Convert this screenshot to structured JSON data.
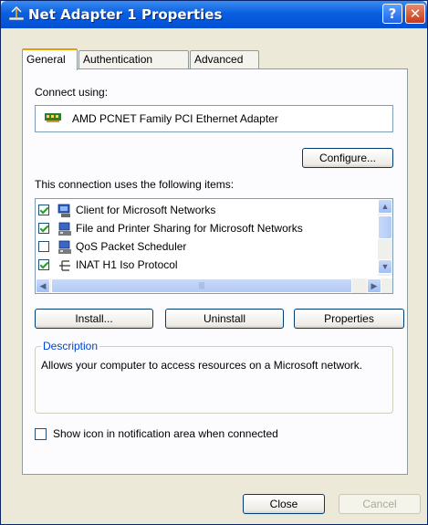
{
  "window": {
    "title": "Net Adapter 1 Properties",
    "help_label": "?",
    "close_label": "✕"
  },
  "tabs": [
    {
      "label": "General",
      "active": true
    },
    {
      "label": "Authentication",
      "active": false
    },
    {
      "label": "Advanced",
      "active": false
    }
  ],
  "general": {
    "connect_using_label": "Connect using:",
    "adapter_name": "AMD PCNET Family PCI Ethernet Adapter",
    "configure_label": "Configure...",
    "items_label": "This connection uses the following items:",
    "items": [
      {
        "label": "Client for Microsoft Networks",
        "checked": true,
        "icon": "network-client-icon"
      },
      {
        "label": "File and Printer Sharing for Microsoft Networks",
        "checked": true,
        "icon": "network-service-icon"
      },
      {
        "label": "QoS Packet Scheduler",
        "checked": false,
        "icon": "network-service-icon"
      },
      {
        "label": "INAT H1 Iso Protocol",
        "checked": true,
        "icon": "protocol-icon"
      }
    ],
    "install_label": "Install...",
    "uninstall_label": "Uninstall",
    "properties_label": "Properties",
    "description_legend": "Description",
    "description_text": "Allows your computer to access resources on a Microsoft network.",
    "notify_label": "Show icon in notification area when connected",
    "notify_checked": false
  },
  "footer": {
    "close_label": "Close",
    "cancel_label": "Cancel",
    "cancel_enabled": false
  },
  "colors": {
    "titlebar": "#0a5fe0",
    "dialog_bg": "#ece9d8",
    "legend_text": "#0046d5"
  }
}
